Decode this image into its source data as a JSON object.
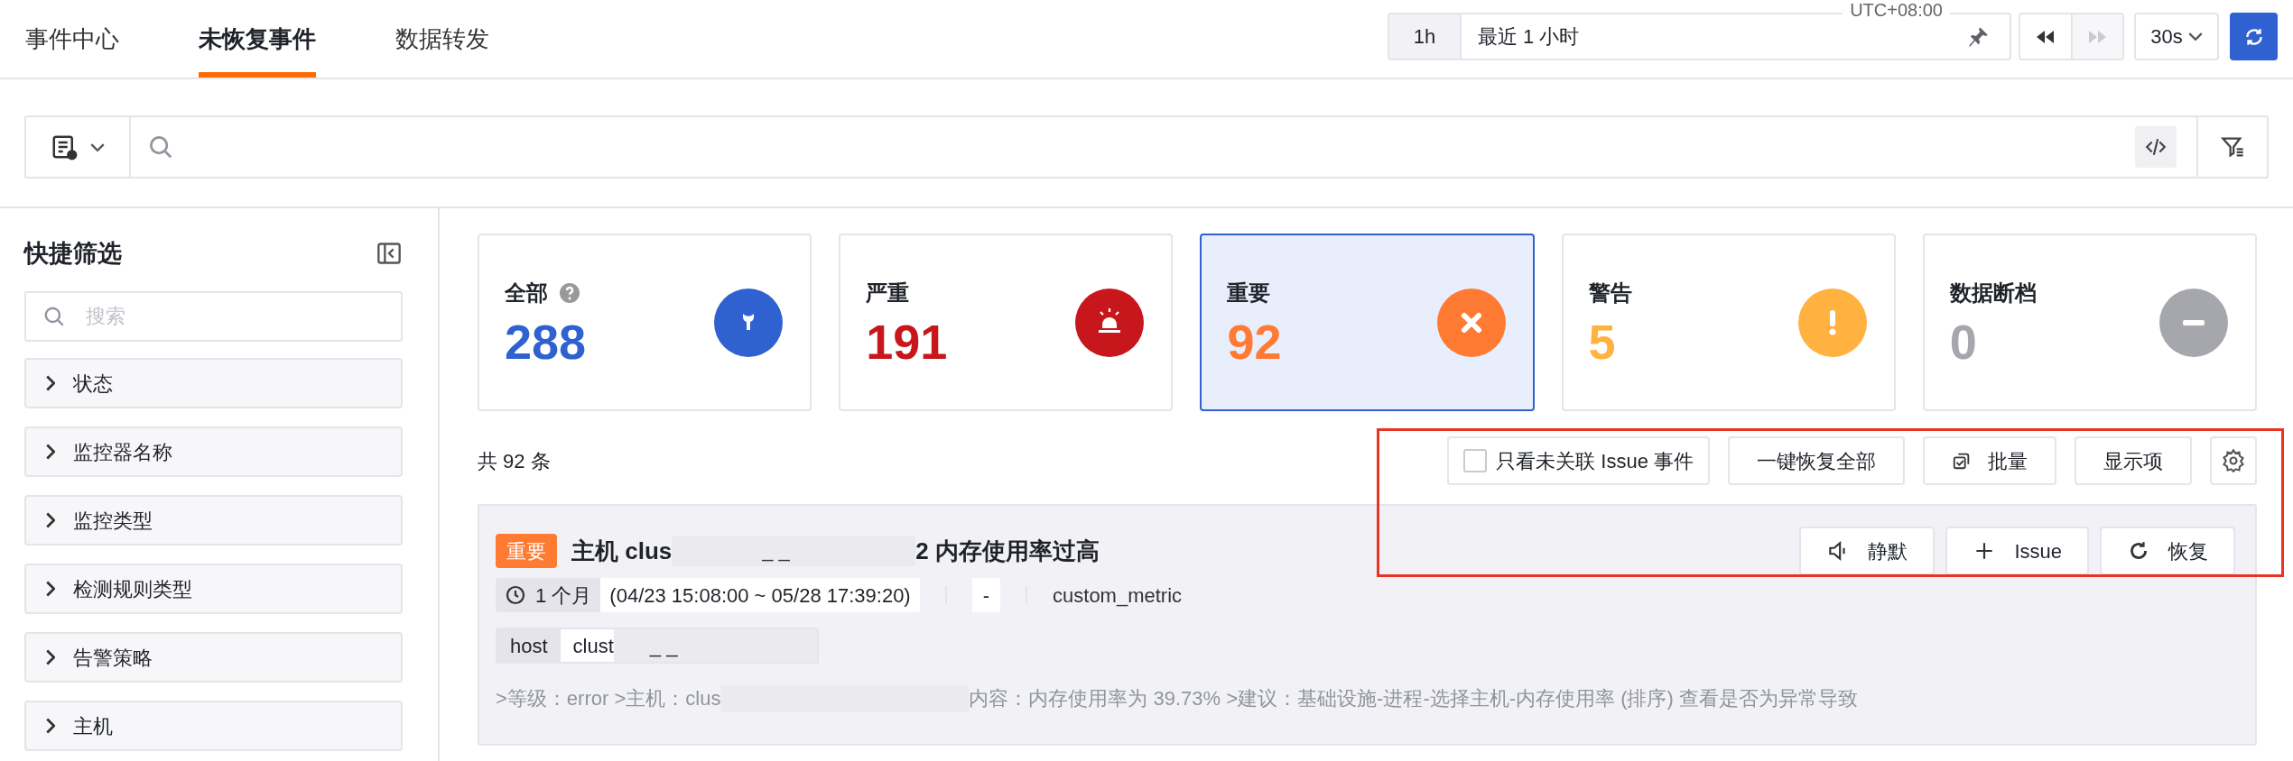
{
  "nav_tabs": [
    {
      "label": "事件中心",
      "selected": false
    },
    {
      "label": "未恢复事件",
      "selected": true
    },
    {
      "label": "数据转发",
      "selected": false
    }
  ],
  "time_picker": {
    "quick": "1h",
    "range": "最近 1 小时",
    "timezone": "UTC+08:00"
  },
  "playback": [
    {
      "kind": "rewind",
      "disabled": false
    },
    {
      "kind": "forward",
      "disabled": true
    }
  ],
  "refresh_interval": "30s",
  "sidebar": {
    "title": "快捷筛选",
    "search_placeholder": "搜索",
    "filters": [
      {
        "label": "状态",
        "expanded": false
      },
      {
        "label": "监控器名称",
        "expanded": false
      },
      {
        "label": "监控类型",
        "expanded": false
      },
      {
        "label": "检测规则类型",
        "expanded": false
      },
      {
        "label": "告警策略",
        "expanded": false
      },
      {
        "label": "主机",
        "expanded": false
      }
    ]
  },
  "summary_cards": [
    {
      "kind": "all",
      "label": "全部",
      "count": "288",
      "color": "#2f62d0",
      "selected": false,
      "help": true
    },
    {
      "kind": "critical",
      "label": "严重",
      "count": "191",
      "color": "#c8161d",
      "selected": false,
      "help": false
    },
    {
      "kind": "error",
      "label": "重要",
      "count": "92",
      "color": "#ff7a33",
      "selected": true,
      "help": false
    },
    {
      "kind": "warning",
      "label": "警告",
      "count": "5",
      "color": "#ffb240",
      "selected": false,
      "help": false
    },
    {
      "kind": "nodata",
      "label": "数据断档",
      "count": "0",
      "color": "#a6a6ad",
      "selected": false,
      "help": false
    }
  ],
  "result_count": "共 92 条",
  "toolbar": {
    "unlinked_only": {
      "label": "只看未关联 Issue 事件",
      "checked": false
    },
    "buttons": [
      {
        "kind": "restore_all",
        "label": "一键恢复全部"
      },
      {
        "kind": "batch",
        "label": "批量"
      },
      {
        "kind": "columns",
        "label": "显示项"
      },
      {
        "kind": "settings"
      }
    ]
  },
  "events": [
    {
      "badge": {
        "label": "重要",
        "color": "#ff7a33"
      },
      "title_start": "主机 clus",
      "title_hidden": "_ _",
      "title_end": "2 内存使用率过高",
      "duration": "1 个月",
      "time_range": "(04/23 15:08:00 ~ 05/28 17:39:20)",
      "column_2": "-",
      "metric": "custom_metric",
      "tags": [
        {
          "key": "host",
          "value": "clust",
          "hidden": "_ _"
        }
      ],
      "content_start": ">等级：error >主机：clus",
      "content_end": "内容：内存使用率为 39.73% >建议：基础设施-进程-选择主机-内存使用率 (排序) 查看是否为异常导致",
      "actions": [
        {
          "kind": "mute",
          "label": "静默"
        },
        {
          "kind": "issue",
          "label": "Issue"
        },
        {
          "kind": "restore",
          "label": "恢复"
        }
      ]
    }
  ]
}
